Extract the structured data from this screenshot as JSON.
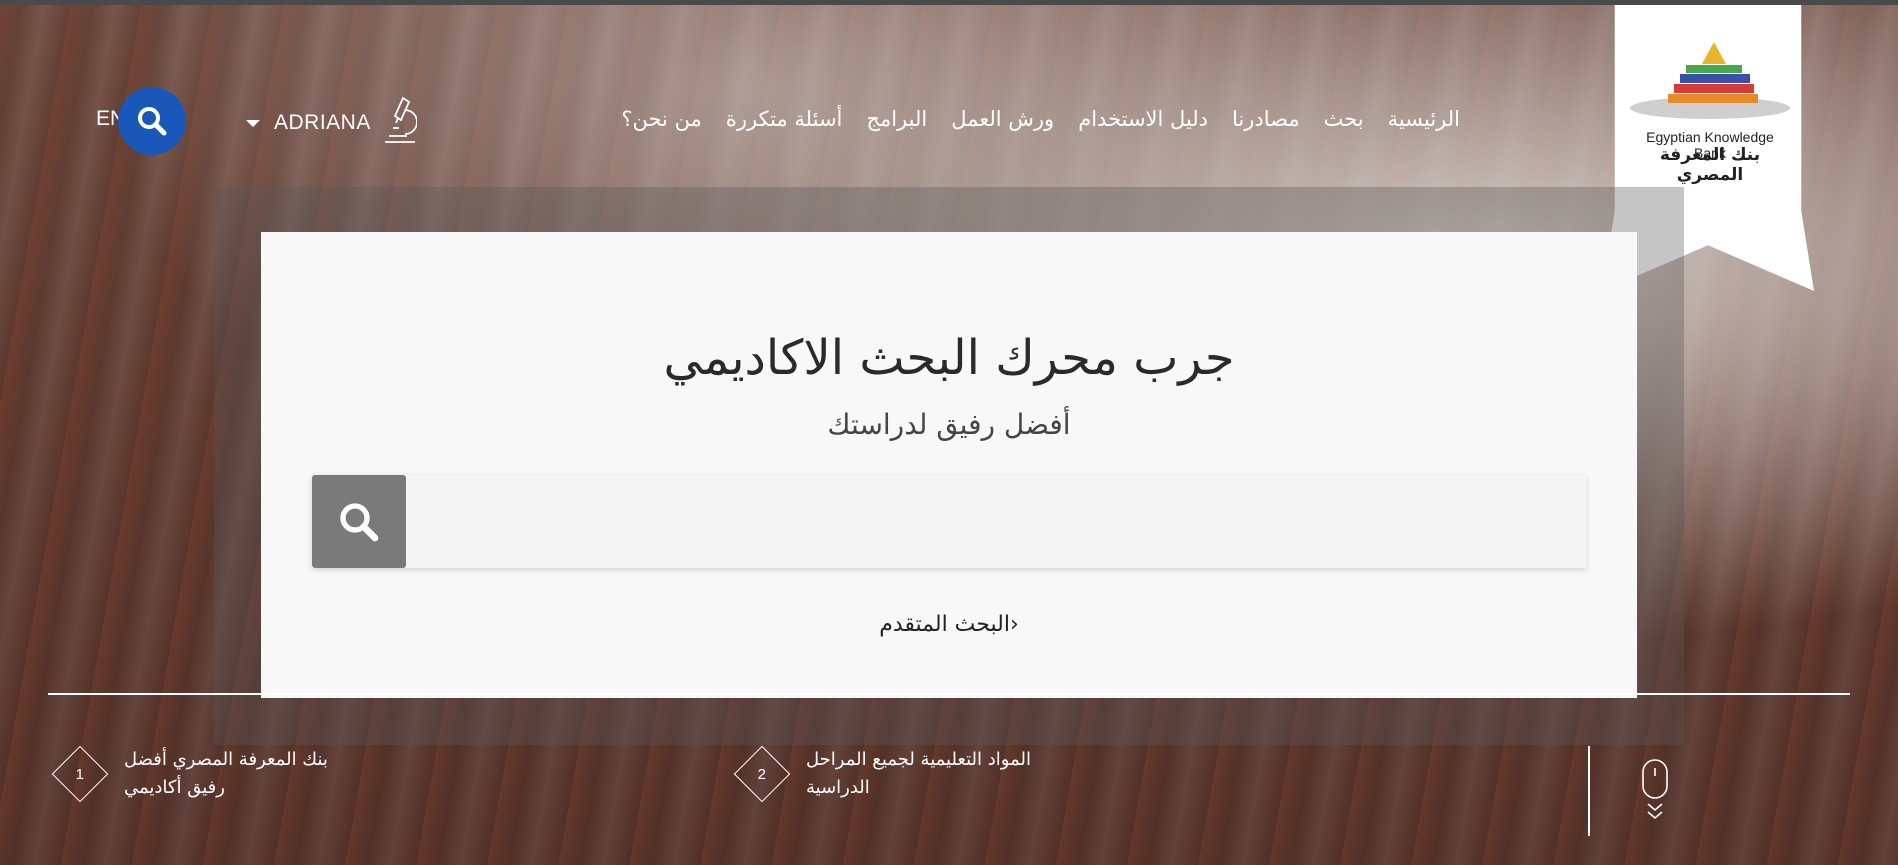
{
  "colors": {
    "accent": "#1958b9",
    "panel": "#f8f8f8",
    "search_button": "#7a7a7a"
  },
  "header": {
    "nav": [
      "الرئيسية",
      "بحث",
      "مصادرنا",
      "دليل الاستخدام",
      "ورش العمل",
      "البرامج",
      "أسئلة متكررة",
      "من نحن؟"
    ],
    "user_name": "ADRIANA",
    "language": "EN",
    "user_icon": "microscope-icon",
    "search_icon": "search-icon"
  },
  "logo": {
    "en": "Egyptian Knowledge Bank",
    "ar": "بنك المعرفة المصري"
  },
  "hero": {
    "title": "جرب محرك البحث الاكاديمي",
    "subtitle": "أفضل رفيق لدراستك",
    "search_placeholder": "",
    "advanced_link": "البحث المتقدم›"
  },
  "features": [
    {
      "number": "1",
      "text": "بنك المعرفة المصري أفضل رفيق أكاديمي"
    },
    {
      "number": "2",
      "text": "المواد التعليمية لجميع المراحل الدراسية"
    }
  ]
}
